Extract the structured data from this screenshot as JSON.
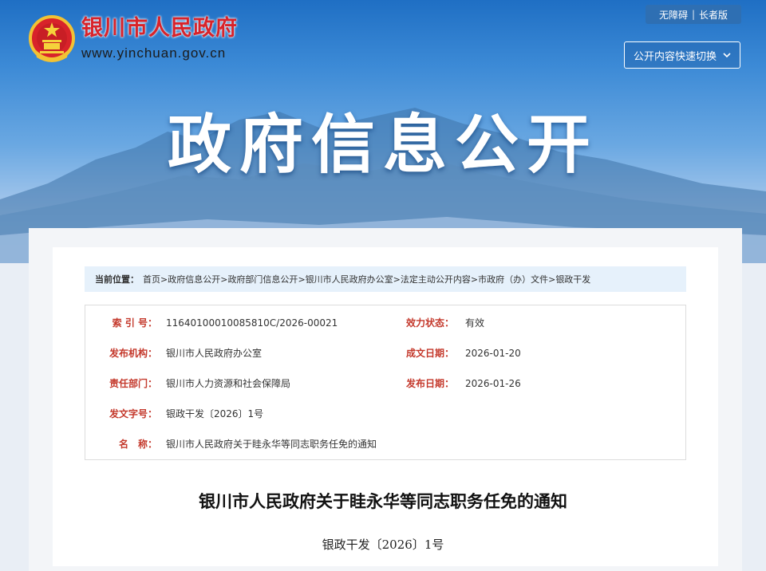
{
  "header": {
    "site_name": "银川市人民政府",
    "site_url": "www.yinchuan.gov.cn",
    "accessibility_link": "无障碍",
    "elder_link": "长者版",
    "quick_switch_label": "公开内容快速切换",
    "banner_title": "政府信息公开"
  },
  "breadcrumb": {
    "label": "当前位置：",
    "items": [
      "首页",
      "政府信息公开",
      "政府部门信息公开",
      "银川市人民政府办公室",
      "法定主动公开内容",
      "市政府（办）文件",
      "银政干发"
    ],
    "separator": ">"
  },
  "metadata": {
    "index_no_label": "索 引 号：",
    "index_no": "11640100010085810C/2026-00021",
    "validity_label": "效力状态：",
    "validity": "有效",
    "issuer_label": "发布机构：",
    "issuer": "银川市人民政府办公室",
    "created_label": "成文日期：",
    "created": "2026-01-20",
    "dept_label": "责任部门：",
    "dept": "银川市人力资源和社会保障局",
    "published_label": "发布日期：",
    "published": "2026-01-26",
    "doc_no_label": "发文字号：",
    "doc_no": "银政干发〔2026〕1号",
    "name_label": "名　称：",
    "name": "银川市人民政府关于眭永华等同志职务任免的通知"
  },
  "document": {
    "title": "银川市人民政府关于眭永华等同志职务任免的通知",
    "number": "银政干发〔2026〕1号"
  },
  "colors": {
    "brand_red": "#d8232a",
    "label_red": "#c4392c",
    "breadcrumb_bg": "#e6f1fb",
    "top_links_bg": "#2e6fb3"
  },
  "icons": {
    "emblem": "national-emblem-icon",
    "dropdown": "chevron-down-icon"
  }
}
